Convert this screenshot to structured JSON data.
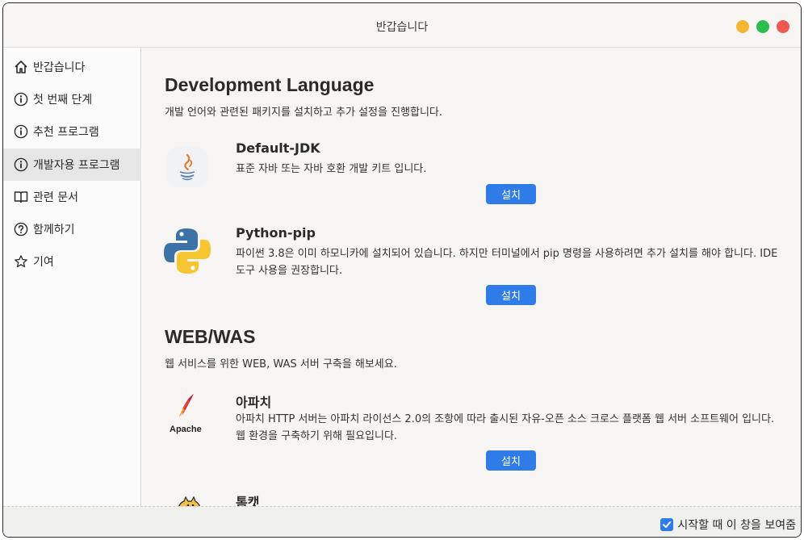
{
  "window": {
    "title": "반갑습니다",
    "controls": [
      {
        "name": "minimize",
        "color": "#f5b731"
      },
      {
        "name": "maximize",
        "color": "#2cbe4e"
      },
      {
        "name": "close",
        "color": "#ee5a52"
      }
    ]
  },
  "sidebar": {
    "items": [
      {
        "label": "반갑습니다",
        "icon": "home-icon"
      },
      {
        "label": "첫 번째 단계",
        "icon": "info-circle-icon"
      },
      {
        "label": "추천 프로그램",
        "icon": "info-circle-icon"
      },
      {
        "label": "개발자용 프로그램",
        "icon": "info-circle-icon",
        "active": true
      },
      {
        "label": "관련 문서",
        "icon": "book-icon"
      },
      {
        "label": "함께하기",
        "icon": "question-circle-icon"
      },
      {
        "label": "기여",
        "icon": "star-icon"
      }
    ]
  },
  "sections": [
    {
      "title": "Development Language",
      "desc": "개발 언어와 관련된 패키지를 설치하고 추가 설정을 진행합니다.",
      "packages": [
        {
          "name": "Default-JDK",
          "icon": "java-icon",
          "desc": "표준 자바 또는 자바 호환 개발 키트 입니다.",
          "button": "설치"
        },
        {
          "name": "Python-pip",
          "icon": "python-icon",
          "desc": "파이썬 3.8은 이미 하모니카에 설치되어 있습니다. 하지만 터미널에서 pip 명령을 사용하려면 추가 설치를 해야 합니다. IDE 도구 사용을 권장합니다.",
          "button": "설치"
        }
      ]
    },
    {
      "title": "WEB/WAS",
      "desc": "웹 서비스를 위한 WEB, WAS 서버 구축을 해보세요.",
      "packages": [
        {
          "name": "아파치",
          "icon": "apache-icon",
          "logo_text": "Apache",
          "desc": "아파치 HTTP 서버는 아파치 라이선스 2.0의 조항에 따라 출시된 자유-오픈 소스 크로스 플랫폼 웹 서버 소프트웨어 입니다. 웹 환경을 구축하기 위해 필요입니다.",
          "button": "설치"
        },
        {
          "name": "톰캣",
          "icon": "tomcat-icon"
        }
      ]
    }
  ],
  "footer": {
    "show_on_startup_label": "시작할 때 이 창을 보여줌",
    "checked": true
  },
  "colors": {
    "accent": "#2f7ce8",
    "active_item": "#e6e6e6"
  }
}
